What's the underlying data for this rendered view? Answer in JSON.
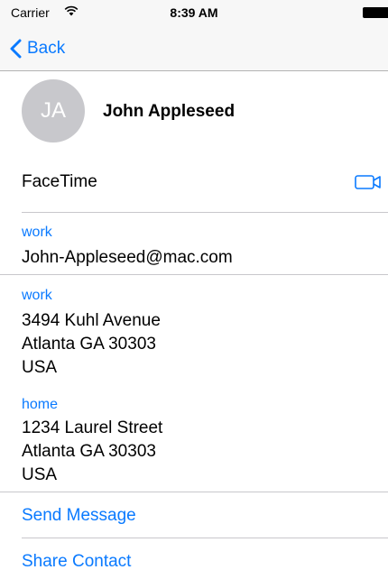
{
  "status_bar": {
    "carrier": "Carrier",
    "time": "8:39 AM"
  },
  "nav": {
    "back_label": "Back"
  },
  "contact": {
    "initials": "JA",
    "name": "John Appleseed"
  },
  "facetime": {
    "label": "FaceTime"
  },
  "email": {
    "label": "work",
    "value": "John-Appleseed@mac.com"
  },
  "addresses": [
    {
      "label": "work",
      "line1": "3494 Kuhl Avenue",
      "line2": "Atlanta GA 30303",
      "line3": "USA"
    },
    {
      "label": "home",
      "line1": "1234 Laurel Street",
      "line2": "Atlanta GA 30303",
      "line3": "USA"
    }
  ],
  "actions": {
    "send_message": "Send Message",
    "share_contact": "Share Contact"
  },
  "colors": {
    "accent": "#0a7aff",
    "avatar_bg": "#c8c8cc",
    "separator": "#c8c7cc"
  }
}
